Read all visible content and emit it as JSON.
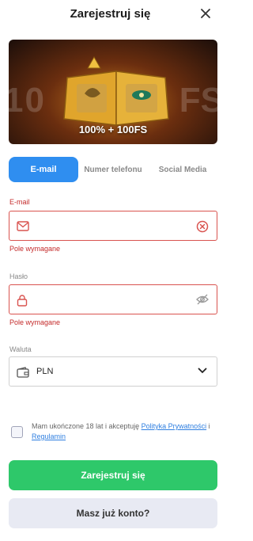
{
  "header": {
    "title": "Zarejestruj się"
  },
  "banner": {
    "promo_text": "100% + 100FS",
    "bg_left": "10",
    "bg_right": "FS"
  },
  "tabs": [
    {
      "label": "E-mail",
      "active": true
    },
    {
      "label": "Numer telefonu",
      "active": false
    },
    {
      "label": "Social Media",
      "active": false
    }
  ],
  "email": {
    "label": "E-mail",
    "value": "",
    "error": "Pole wymagane"
  },
  "password": {
    "label": "Hasło",
    "value": "",
    "error": "Pole wymagane"
  },
  "currency": {
    "label": "Waluta",
    "value": "PLN"
  },
  "terms": {
    "text_before": "Mam ukończone 18 lat i akceptuję ",
    "privacy_link": "Polityka Prywatności",
    "and": " i ",
    "rules_link": "Regulamin"
  },
  "buttons": {
    "register": "Zarejestruj się",
    "login": "Masz już konto?"
  },
  "colors": {
    "accent": "#2f8ef0",
    "error": "#c42b2b",
    "success": "#2ec86a"
  }
}
